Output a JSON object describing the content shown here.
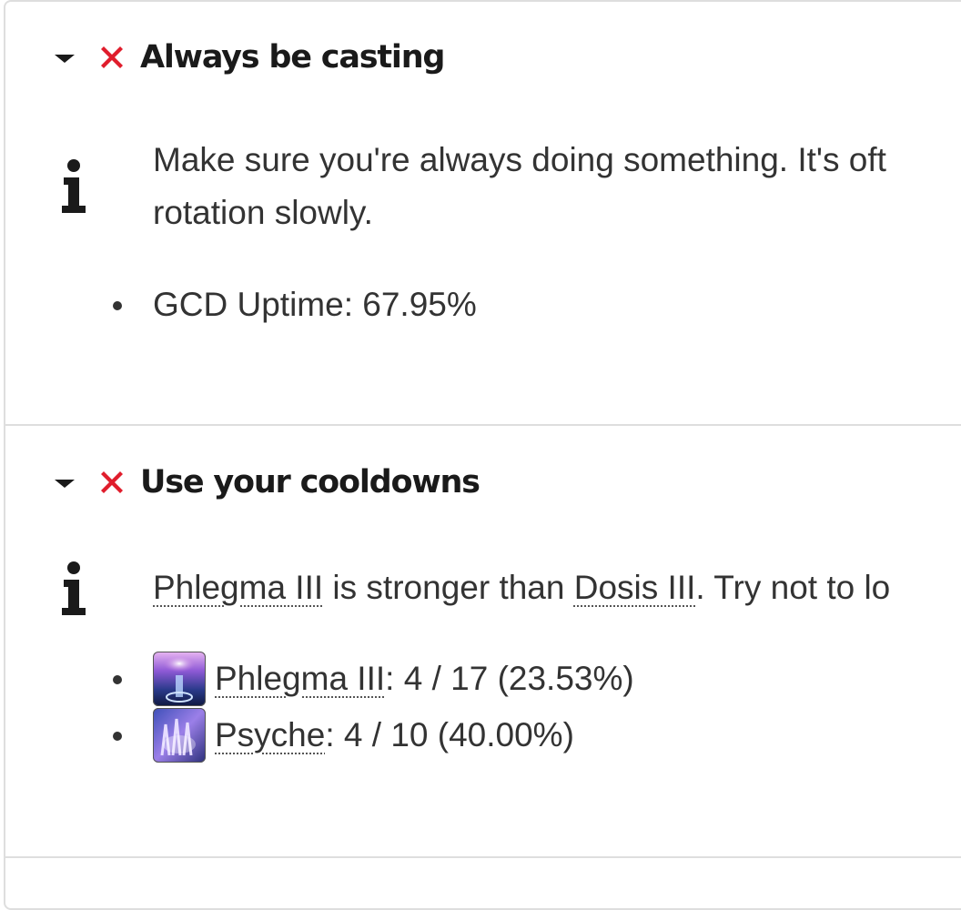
{
  "checks": [
    {
      "title": "Always be casting",
      "status_icon": "fail-x-icon",
      "status_color": "#e01d2c",
      "description": "Make sure you're always doing something. It's oft",
      "description_line2": "rotation slowly.",
      "metrics": [
        {
          "text": "GCD Uptime: 67.95%"
        }
      ]
    },
    {
      "title": "Use your cooldowns",
      "status_icon": "fail-x-icon",
      "status_color": "#e01d2c",
      "description_link1": "Phlegma III",
      "description_mid": " is stronger than ",
      "description_link2": "Dosis III",
      "description_tail": ". Try not to lo",
      "metrics": [
        {
          "link": "Phlegma III",
          "value": ": 4 / 17 (23.53%)",
          "icon": "phlegma-iii-icon"
        },
        {
          "link": "Psyche",
          "value": ": 4 / 10 (40.00%)",
          "icon": "psyche-icon"
        }
      ]
    }
  ],
  "icons": {
    "caret": "caret-down-icon",
    "info": "info-icon"
  }
}
